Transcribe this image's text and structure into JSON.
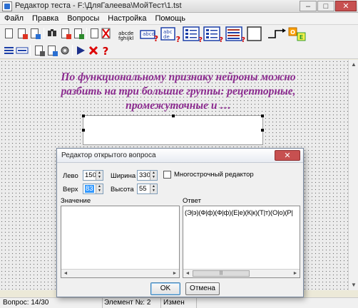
{
  "window": {
    "title": "Редактор теста - F:\\ДляГалеева\\МойТест\\1.tst"
  },
  "window_controls": {
    "minimize": "–",
    "maximize": "□",
    "close": "✕"
  },
  "menu": [
    "Файл",
    "Правка",
    "Вопросы",
    "Настройка",
    "Помощь"
  ],
  "toolbar": {
    "row1_icons": [
      "new-test-icon",
      "open-test-icon",
      "save-test-icon",
      "find-icon",
      "cut-icon",
      "paste-icon",
      "new-page-icon",
      "delete-page-icon"
    ],
    "row2_icons": [
      "list-icon",
      "field-icon",
      "copy-icon",
      "edit-icon",
      "settings-icon",
      "run-icon",
      "delete-icon",
      "help-icon"
    ],
    "element_text_sample": [
      "abcde",
      "fghijkl"
    ],
    "element_open_sample": "abcd",
    "element_answer_sample": [
      "abc",
      "de"
    ]
  },
  "question": {
    "text": "По функциональному признаку нейроны можно разбить на три большие группы: рецепторные, промежуточные и …"
  },
  "status": {
    "question_counter": "Вопрос: 14/30",
    "element": "Элемент №: 2",
    "mode": "Измен"
  },
  "dialog": {
    "title": "Редактор открытого вопроса",
    "close": "✕",
    "left_label": "Лево",
    "left_value": "150",
    "width_label": "Ширина",
    "width_value": "330",
    "top_label": "Верх",
    "top_value": "83",
    "height_label": "Высота",
    "height_value": "55",
    "multiline_label": "Многострочный редактор",
    "multiline_checked": false,
    "value_label": "Значение",
    "answer_label": "Ответ",
    "answer_text": "(Э|э)(Ф|ф)(Ф|ф)(Е|е)(К|к)(Т|т)(О|о)(Р|",
    "ok": "OK",
    "cancel": "Отмена"
  },
  "colors": {
    "question_text": "#8b2a8f",
    "canvas_dots": "#6e6e6e",
    "close_red": "#c75050"
  }
}
